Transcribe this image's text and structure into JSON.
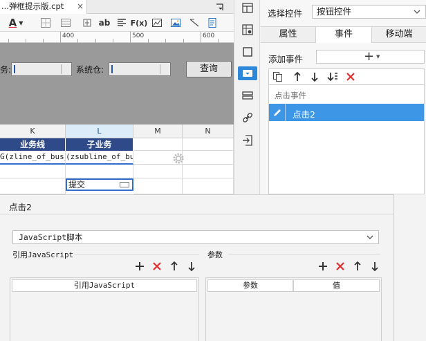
{
  "editor": {
    "file_tab": "...弹框提示版.cpt",
    "file_tab_close": "×",
    "toolbar": {
      "font_color_letter": "A",
      "ab_label": "ab",
      "formula_label": "F(x)"
    },
    "ruler": {
      "labels": [
        "400",
        "500",
        "600"
      ]
    },
    "params": {
      "business_label": "务:",
      "system_label": "系统仓:",
      "query_button": "查询"
    },
    "grid": {
      "columns": [
        "K",
        "L",
        "M",
        "N"
      ],
      "selected_column": "L",
      "headers": [
        "业务线",
        "子业务"
      ],
      "cells": {
        "k_formula": "G(zline_of_bus_d",
        "l_formula": "(zsubline_of_bus",
        "l_submit": "提交"
      }
    }
  },
  "icon_bar": {
    "icons": [
      "cell-attribute-icon",
      "cell-element-icon",
      "widget-settings-icon",
      "widget-icon",
      "condition-attr-icon",
      "hyperlink-icon",
      "data-entry-icon"
    ],
    "active": "widget-icon"
  },
  "right_panel": {
    "select_control_label": "选择控件",
    "select_control_value": "按钮控件",
    "tabs": [
      "属性",
      "事件",
      "移动端"
    ],
    "active_tab": "事件",
    "add_event_label": "添加事件",
    "add_event_button": "+",
    "event_group": "点击事件",
    "selected_event": "点击2"
  },
  "dialog": {
    "title": "点击2",
    "script_type": "JavaScript脚本",
    "ref_js_label": "引用JavaScript",
    "params_label": "参数",
    "ref_js_column": "引用JavaScript",
    "param_columns": [
      "参数",
      "值"
    ]
  },
  "colors": {
    "accent_blue": "#3d97e6",
    "header_navy": "#2f4a89",
    "delete_red": "#e03030",
    "param_area_gray": "#9a9a9a"
  }
}
